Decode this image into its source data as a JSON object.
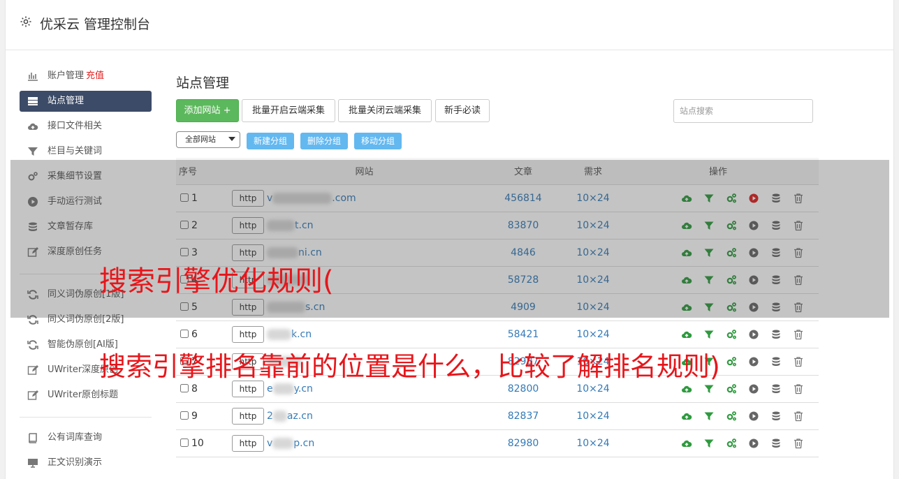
{
  "header": {
    "title": "优采云 管理控制台"
  },
  "sidebar": {
    "group1": [
      {
        "icon": "bar-chart-icon",
        "label": "账户管理",
        "extra": "充值"
      },
      {
        "icon": "server-icon",
        "label": "站点管理",
        "active": true
      },
      {
        "icon": "cloud-upload-icon",
        "label": "接口文件相关"
      },
      {
        "icon": "filter-icon",
        "label": "栏目与关键词"
      },
      {
        "icon": "gears-icon",
        "label": "采集细节设置"
      },
      {
        "icon": "play-circle-icon",
        "label": "手动运行测试"
      },
      {
        "icon": "database-icon",
        "label": "文章暂存库"
      },
      {
        "icon": "edit-icon",
        "label": "深度原创任务"
      }
    ],
    "group2": [
      {
        "icon": "refresh-icon",
        "label": "同义词伪原创[1版]"
      },
      {
        "icon": "refresh-icon",
        "label": "同义词伪原创[2版]"
      },
      {
        "icon": "refresh-icon",
        "label": "智能伪原创[AI版]"
      },
      {
        "icon": "edit-icon",
        "label": "UWriter深度原创"
      },
      {
        "icon": "edit-icon",
        "label": "UWriter原创标题"
      }
    ],
    "group3": [
      {
        "icon": "book-icon",
        "label": "公有词库查询"
      },
      {
        "icon": "monitor-icon",
        "label": "正文识别演示"
      }
    ]
  },
  "main": {
    "title": "站点管理",
    "toolbar": {
      "add": "添加网站 +",
      "batch_open": "批量开启云端采集",
      "batch_close": "批量关闭云端采集",
      "guide": "新手必读",
      "search_placeholder": "站点搜索"
    },
    "group_select": "全部网站",
    "group_buttons": {
      "new": "新建分组",
      "delete": "删除分组",
      "move": "移动分组"
    },
    "table": {
      "headers": {
        "no": "序号",
        "site": "网站",
        "articles": "文章",
        "demand": "需求",
        "ops": "操作"
      },
      "protocol": "http",
      "rows": [
        {
          "no": "1",
          "site_prefix": "v",
          "site_suffix": ".com",
          "articles": "456814",
          "demand": "10×24",
          "running": true
        },
        {
          "no": "2",
          "site_prefix": "",
          "site_suffix": "t.cn",
          "articles": "83870",
          "demand": "10×24"
        },
        {
          "no": "3",
          "site_prefix": "",
          "site_suffix": "ni.cn",
          "articles": "4846",
          "demand": "10×24"
        },
        {
          "no": "4",
          "site_prefix": "",
          "site_suffix": "",
          "articles": "58728",
          "demand": "10×24"
        },
        {
          "no": "5",
          "site_prefix": "",
          "site_suffix": "s.cn",
          "articles": "4909",
          "demand": "10×24"
        },
        {
          "no": "6",
          "site_prefix": "",
          "site_suffix": "k.cn",
          "articles": "58421",
          "demand": "10×24"
        },
        {
          "no": "7",
          "site_prefix": "",
          "site_suffix": "",
          "articles": "82987",
          "demand": "10×24"
        },
        {
          "no": "8",
          "site_prefix": "e",
          "site_suffix": "y.cn",
          "articles": "82800",
          "demand": "10×24"
        },
        {
          "no": "9",
          "site_prefix": "2",
          "site_suffix": "az.cn",
          "articles": "82837",
          "demand": "10×24"
        },
        {
          "no": "10",
          "site_prefix": "v",
          "site_suffix": "p.cn",
          "articles": "82980",
          "demand": "10×24"
        }
      ]
    }
  },
  "captions": {
    "line1": "搜索引擎优化规则(",
    "line2": "搜索引擎排名靠前的位置是什么，比较了解排名规则)"
  },
  "colors": {
    "caption": "#e6161b",
    "active_nav": "#3c4b67",
    "green_button": "#5cb85c",
    "link_blue": "#337ab7"
  }
}
